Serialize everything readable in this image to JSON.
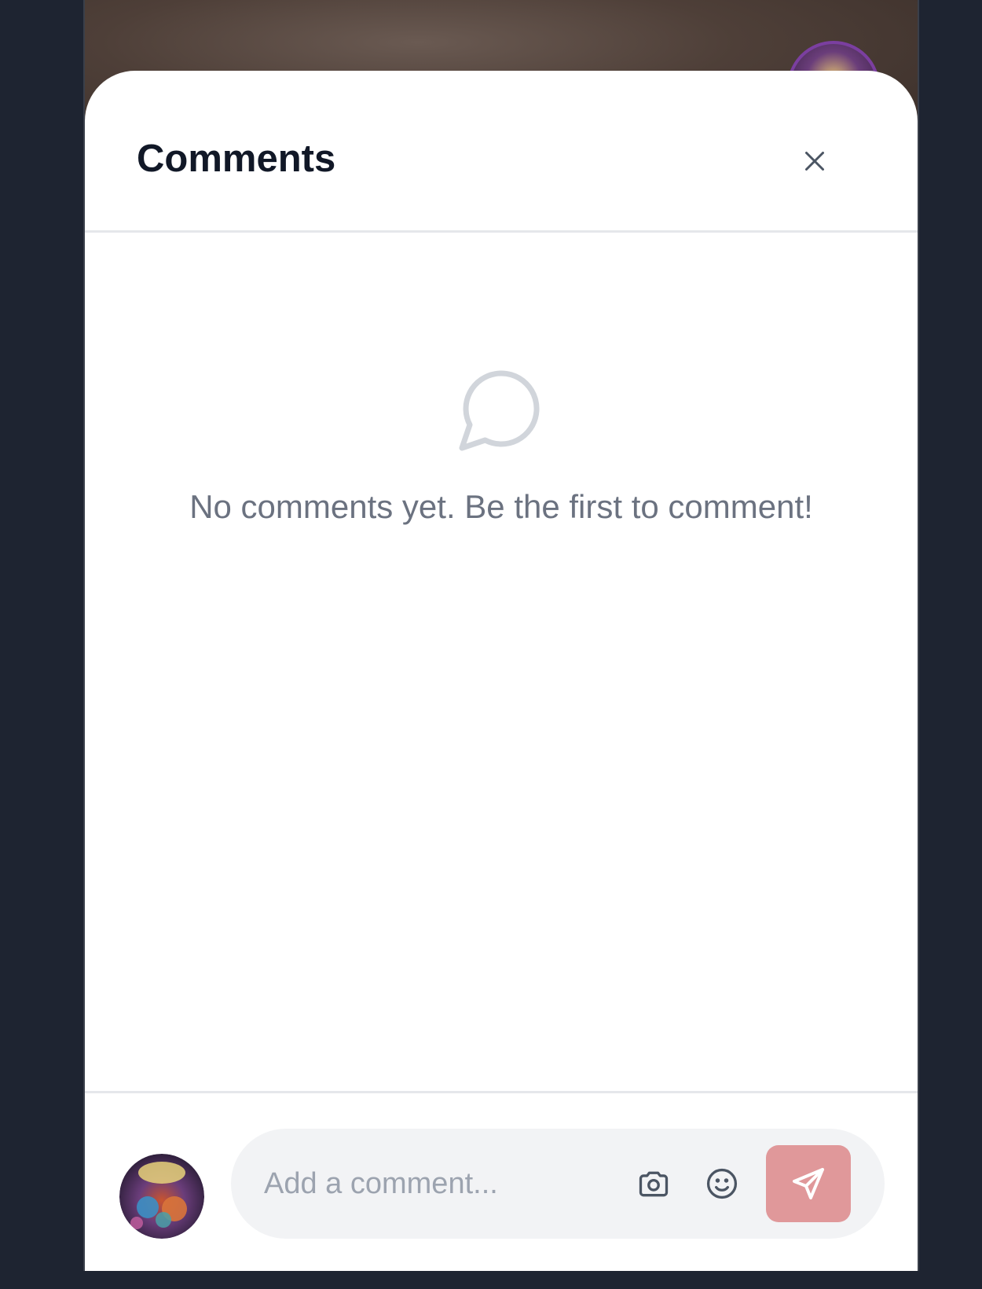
{
  "sheet": {
    "title": "Comments"
  },
  "empty_state": {
    "message": "No comments yet. Be the first to comment!"
  },
  "composer": {
    "placeholder": "Add a comment...",
    "value": ""
  },
  "icons": {
    "close": "close-icon",
    "empty": "chat-bubble-icon",
    "camera": "camera-icon",
    "emoji": "smile-icon",
    "send": "send-icon"
  },
  "colors": {
    "backdrop": "#1e2431",
    "title": "#111827",
    "muted_text": "#6b7280",
    "input_background": "#f2f3f5",
    "send_button": "#e0989a",
    "divider": "#e5e7eb"
  }
}
